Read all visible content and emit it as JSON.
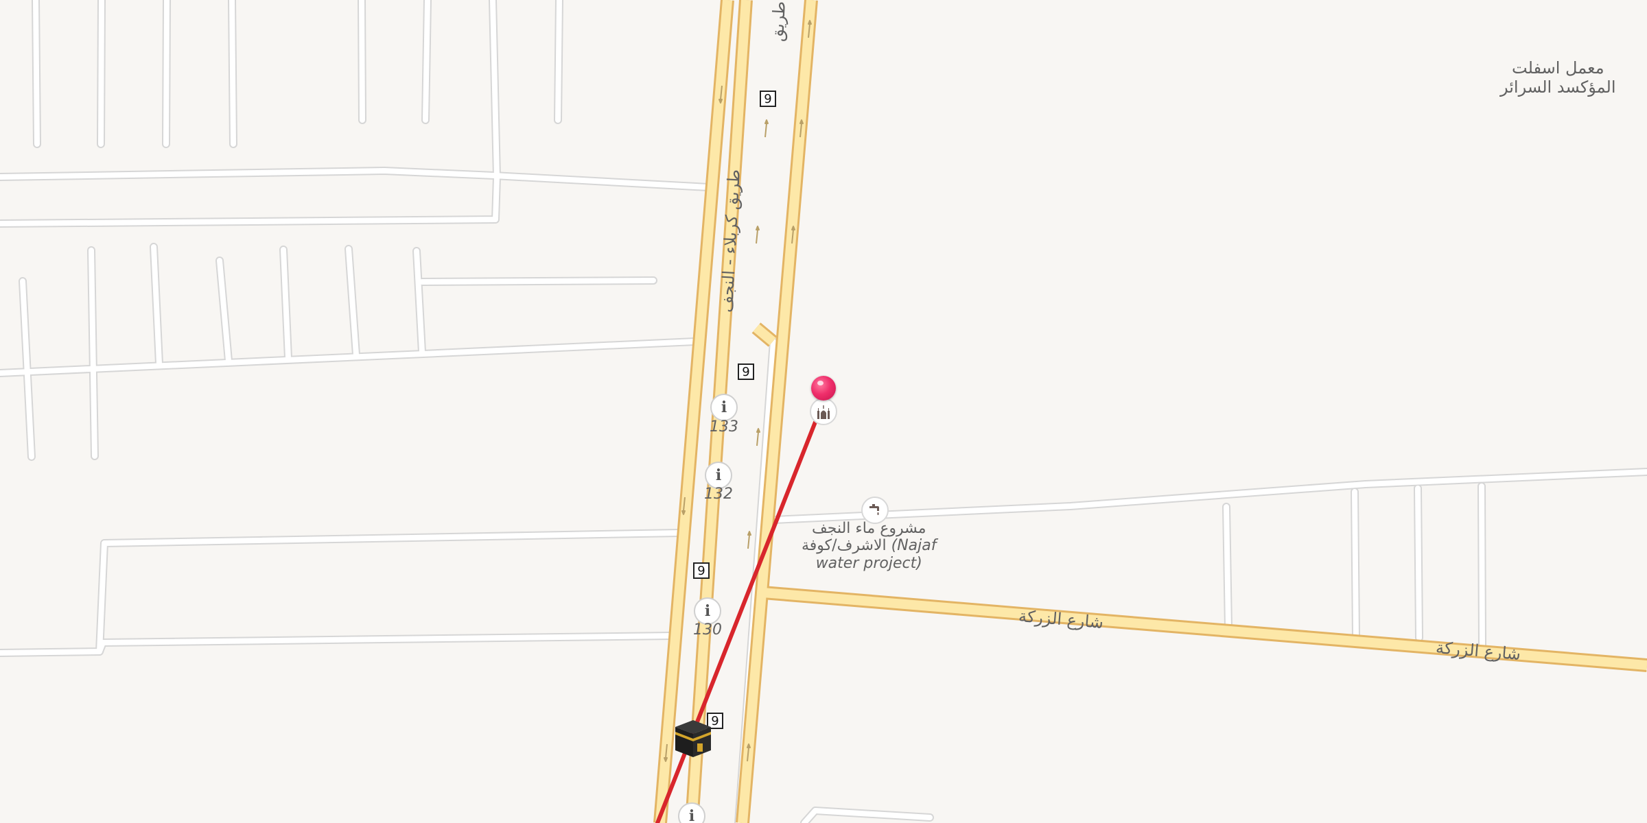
{
  "map": {
    "colors": {
      "background": "#f8f6f3",
      "minor_road_casing": "#d9d9d9",
      "minor_road_fill": "#ffffff",
      "main_road_casing": "#e8b86a",
      "main_road_fill": "#fde7a6",
      "route_line": "#d8262c",
      "pin": "#ef2f6b"
    },
    "labels": {
      "asphalt_factory": [
        "معمل اسفلت",
        "المؤكسد السرائر"
      ],
      "road_top_fragment": "طريق",
      "road_main_vertical": "طريق كربلاء - النجف",
      "water_project": [
        "مشروع ماء النجف",
        "الاشرف/كوفة",
        "(Najaf",
        "water project)"
      ],
      "street_1": "شارع الزركة",
      "street_2": "شارع الزركة"
    },
    "route_shields": [
      "9",
      "9",
      "9",
      "9"
    ],
    "km_markers": [
      "133",
      "132",
      "130",
      ""
    ],
    "icons": {
      "mosque": "mosque-icon",
      "water_project": "water-tap-icon",
      "kaaba": "kaaba-icon",
      "pin": "map-pin-icon",
      "info": "info-icon"
    }
  }
}
